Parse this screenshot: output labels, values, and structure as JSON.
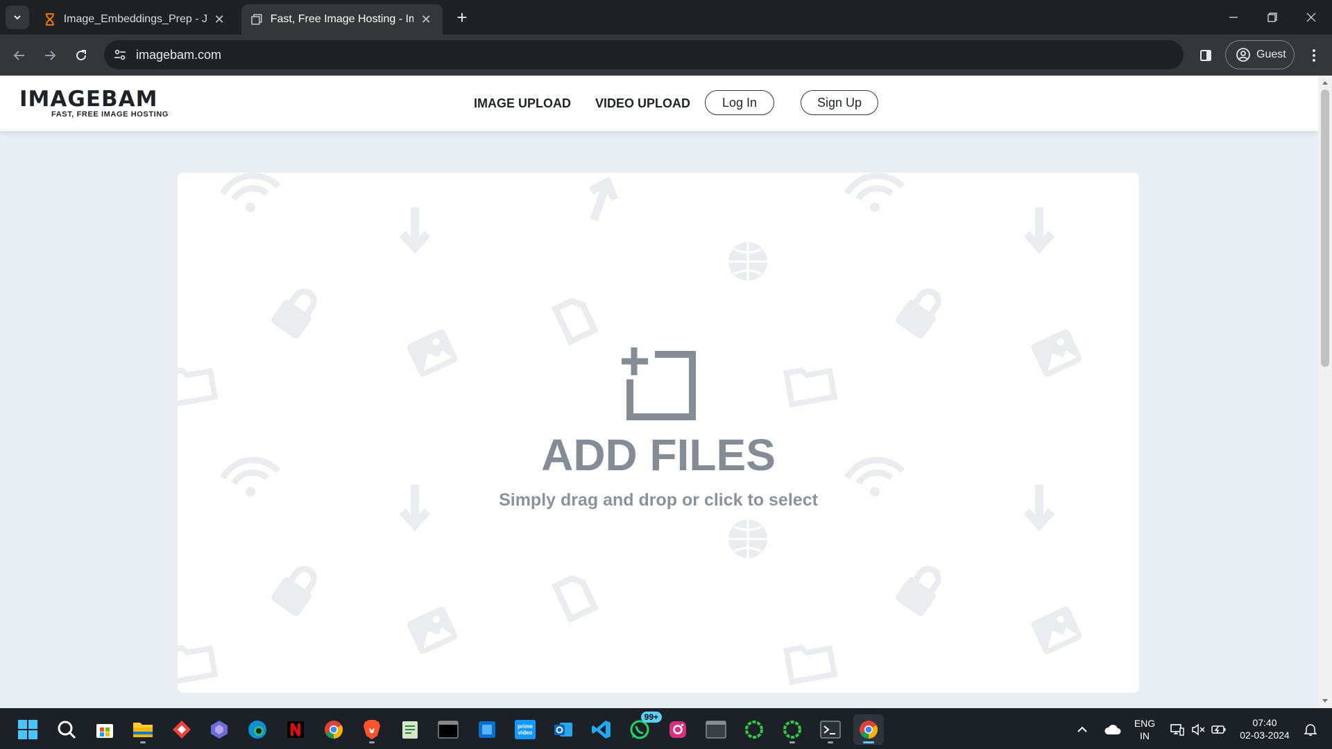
{
  "browser": {
    "tabs": [
      {
        "title": "Image_Embeddings_Prep - Jupyter",
        "icon": "hourglass-icon",
        "active": false
      },
      {
        "title": "Fast, Free Image Hosting - ImageBam",
        "icon": "pages-icon",
        "active": true
      }
    ],
    "url": "imagebam.com",
    "profile_label": "Guest"
  },
  "site": {
    "logo_main": "IMAGEBAM",
    "logo_sub": "FAST, FREE IMAGE HOSTING",
    "nav": {
      "image_upload": "IMAGE UPLOAD",
      "video_upload": "VIDEO UPLOAD",
      "login": "Log In",
      "signup": "Sign Up"
    },
    "upload": {
      "title": "ADD FILES",
      "subtitle": "Simply drag and drop or click to select"
    }
  },
  "taskbar": {
    "apps": [
      "start-icon",
      "search-icon",
      "store-icon",
      "file-explorer-icon",
      "anydesk-icon",
      "copilot-icon",
      "edge-icon",
      "netflix-icon",
      "chrome-icon",
      "brave-icon",
      "notepad-icon",
      "terminal-icon",
      "widgets-icon",
      "prime-video-icon",
      "outlook-icon",
      "vscode-icon",
      "whatsapp-icon",
      "instagram-icon",
      "window-icon",
      "loader-icon",
      "loader-icon-2",
      "powershell-icon",
      "chrome-active-icon"
    ],
    "whatsapp_badge": "99+",
    "prime_label": "prime video",
    "lang_top": "ENG",
    "lang_bottom": "IN",
    "time": "07:40",
    "date": "02-03-2024"
  },
  "colors": {
    "accent": "#60cdff",
    "upload_text": "#858c96",
    "page_bg": "#e9eef5"
  }
}
